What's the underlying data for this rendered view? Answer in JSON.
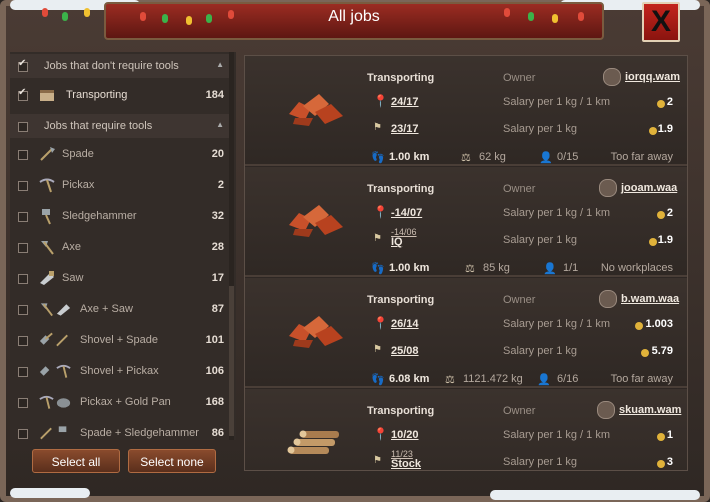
{
  "window": {
    "title": "All jobs",
    "close_label": "X"
  },
  "filters": {
    "no_tools_header": "Jobs that don't require tools",
    "tools_header": "Jobs that require tools",
    "items": [
      {
        "label": "Transporting",
        "count": "184",
        "icon": "transport-icon"
      },
      {
        "label": "Spade",
        "count": "20",
        "icon": "spade-icon"
      },
      {
        "label": "Pickax",
        "count": "2",
        "icon": "pickax-icon"
      },
      {
        "label": "Sledgehammer",
        "count": "32",
        "icon": "sledgehammer-icon"
      },
      {
        "label": "Axe",
        "count": "28",
        "icon": "axe-icon"
      },
      {
        "label": "Saw",
        "count": "17",
        "icon": "saw-icon"
      },
      {
        "label": "Axe + Saw",
        "count": "87",
        "icon": "axe-saw-icon"
      },
      {
        "label": "Shovel + Spade",
        "count": "101",
        "icon": "shovel-spade-icon"
      },
      {
        "label": "Shovel + Pickax",
        "count": "106",
        "icon": "shovel-pickax-icon"
      },
      {
        "label": "Pickax + Gold Pan",
        "count": "168",
        "icon": "pickax-goldpan-icon"
      },
      {
        "label": "Spade + Sledgehammer",
        "count": "86",
        "icon": "spade-sledgehammer-icon"
      }
    ],
    "select_all": "Select all",
    "select_none": "Select none"
  },
  "jobs": [
    {
      "type": "Transporting",
      "owner_label": "Owner",
      "owner": "iorqq.wam",
      "from": "24/17",
      "to": "23/17",
      "to_sub": "",
      "salary1_label": "Salary per 1 kg / 1 km",
      "salary1": "2",
      "salary2_label": "Salary per 1 kg",
      "salary2": "1.9",
      "distance": "1.00 km",
      "weight": "62 kg",
      "workers": "0/15",
      "status": "Too far away",
      "resource": "copper-ore"
    },
    {
      "type": "Transporting",
      "owner_label": "Owner",
      "owner": "jooam.waa",
      "from": "-14/07",
      "to": "IQ",
      "to_sub": "-14/06",
      "salary1_label": "Salary per 1 kg / 1 km",
      "salary1": "2",
      "salary2_label": "Salary per 1 kg",
      "salary2": "1.9",
      "distance": "1.00 km",
      "weight": "85 kg",
      "workers": "1/1",
      "status": "No workplaces",
      "resource": "copper-ore"
    },
    {
      "type": "Transporting",
      "owner_label": "Owner",
      "owner": "b.wam.waa",
      "from": "26/14",
      "to": "25/08",
      "to_sub": "",
      "salary1_label": "Salary per 1 kg / 1 km",
      "salary1": "1.003",
      "salary2_label": "Salary per 1 kg",
      "salary2": "5.79",
      "distance": "6.08 km",
      "weight": "1121.472 kg",
      "workers": "6/16",
      "status": "Too far away",
      "resource": "copper-ore"
    },
    {
      "type": "Transporting",
      "owner_label": "Owner",
      "owner": "skuam.wam",
      "from": "10/20",
      "to": "Stock",
      "to_sub": "11/23",
      "salary1_label": "Salary per 1 kg / 1 km",
      "salary1": "1",
      "salary2_label": "Salary per 1 kg",
      "salary2": "3",
      "distance": "",
      "weight": "",
      "workers": "",
      "status": "",
      "resource": "logs"
    }
  ]
}
